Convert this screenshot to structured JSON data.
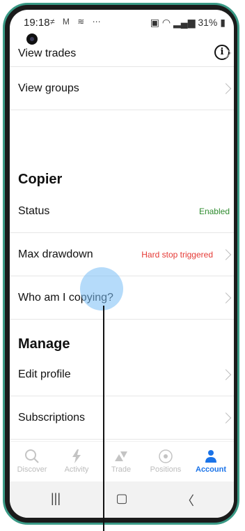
{
  "status_bar": {
    "time": "19:18",
    "notification_icons": "≠ M ≋ ⋯",
    "battery": "31%"
  },
  "list": {
    "partial_top_item": "View trades",
    "view_groups": "View groups",
    "copier_heading": "Copier",
    "status_label": "Status",
    "status_value": "Enabled",
    "max_drawdown_label": "Max drawdown",
    "max_drawdown_value": "Hard stop triggered",
    "who_am_i_copying": "Who am I copying?",
    "manage_heading": "Manage",
    "edit_profile": "Edit profile",
    "subscriptions": "Subscriptions"
  },
  "bottom_nav": {
    "items": [
      {
        "label": "Discover",
        "icon": "search-icon"
      },
      {
        "label": "Activity",
        "icon": "bolt-icon"
      },
      {
        "label": "Trade",
        "icon": "trade-arrows-icon"
      },
      {
        "label": "Positions",
        "icon": "target-icon"
      },
      {
        "label": "Account",
        "icon": "person-icon"
      }
    ],
    "active": "Account"
  },
  "colors": {
    "enabled": "#2e8b2e",
    "warning": "#e53935",
    "accent": "#1a73e8",
    "frame": "#3a9a86"
  }
}
